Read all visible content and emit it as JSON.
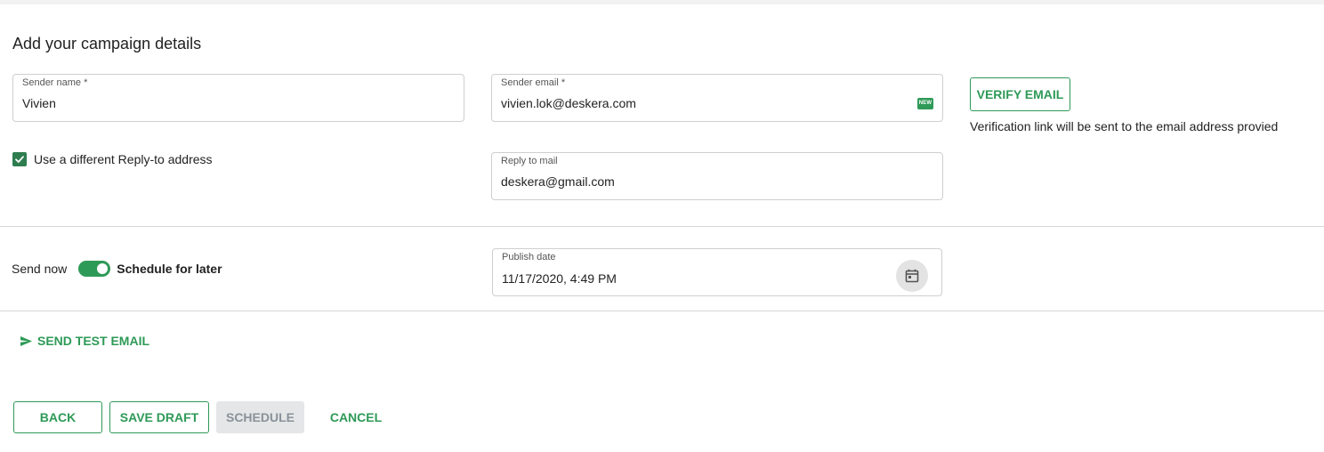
{
  "title": "Add your campaign details",
  "sender_name": {
    "label": "Sender name *",
    "value": "Vivien"
  },
  "sender_email": {
    "label": "Sender email *",
    "value": "vivien.lok@deskera.com",
    "badge": "NEW"
  },
  "verify": {
    "button_label": "VERIFY EMAIL",
    "hint": "Verification link will be sent to the email address provied"
  },
  "reply": {
    "checkbox_label": "Use a different Reply-to address",
    "checked": true,
    "label": "Reply to mail",
    "value": "deskera@gmail.com"
  },
  "schedule": {
    "send_now_label": "Send now",
    "toggle_on": true,
    "later_label": "Schedule for later"
  },
  "publish": {
    "label": "Publish date",
    "value": "11/17/2020, 4:49 PM",
    "icon": "calendar-icon"
  },
  "test_email": {
    "label": "SEND TEST EMAIL",
    "icon": "send-icon"
  },
  "actions": {
    "back": "BACK",
    "save_draft": "SAVE DRAFT",
    "schedule": "SCHEDULE",
    "cancel": "CANCEL"
  },
  "colors": {
    "accent": "#2e9a57",
    "disabled_bg": "#e4e6e8",
    "disabled_text": "#8a9199"
  }
}
